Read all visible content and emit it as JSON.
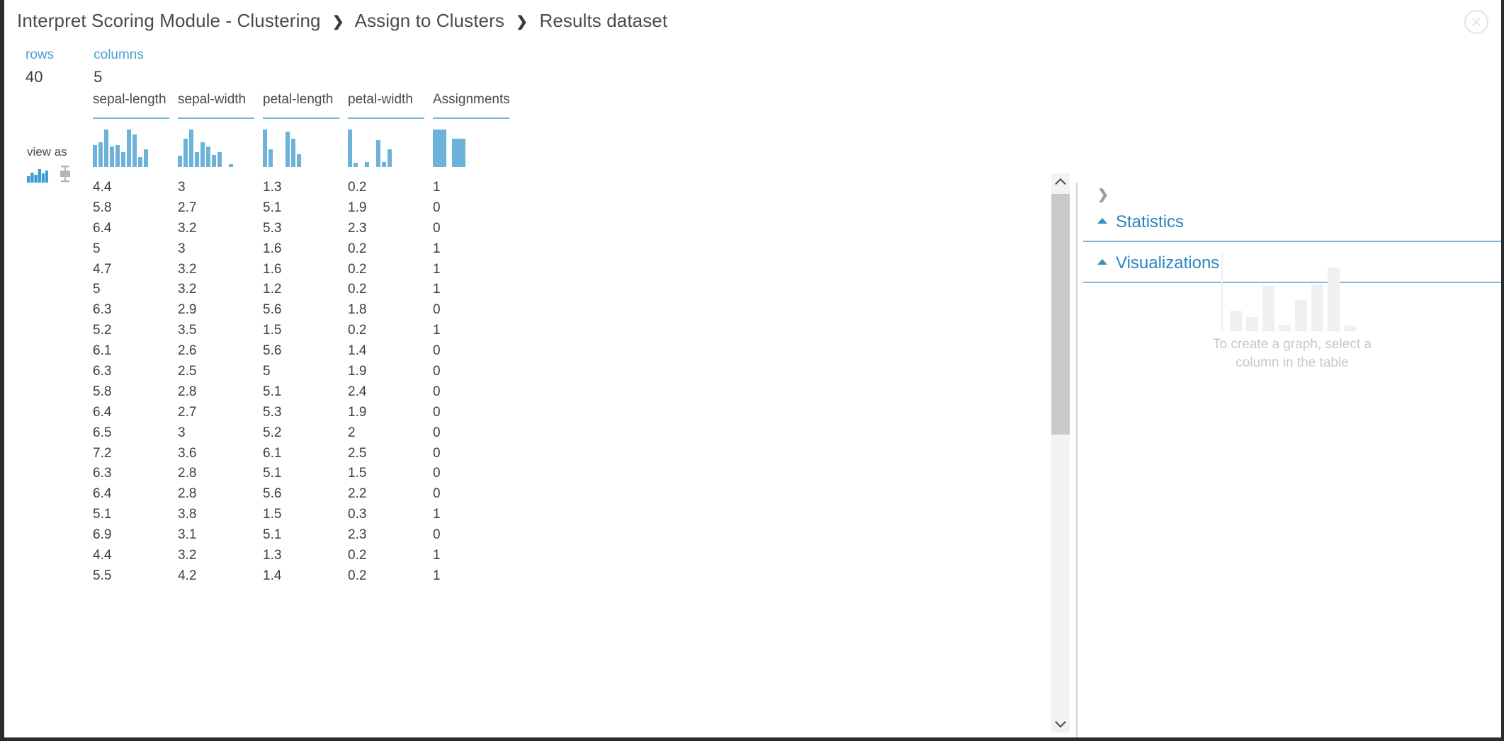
{
  "window": {
    "close_icon": "close-circle-icon"
  },
  "breadcrumb": {
    "separator": "❯",
    "items": [
      "Interpret Scoring Module - Clustering",
      "Assign to Clusters",
      "Results dataset"
    ]
  },
  "counters": [
    {
      "label": "rows",
      "value": "40"
    },
    {
      "label": "columns",
      "value": "5"
    }
  ],
  "view_as": {
    "label": "view as",
    "options": [
      {
        "name": "histogram-icon",
        "selected": true
      },
      {
        "name": "boxplot-icon",
        "selected": false
      }
    ]
  },
  "table": {
    "columns": [
      "sepal-length",
      "sepal-width",
      "petal-length",
      "petal-width",
      "Assignments"
    ],
    "rows": [
      [
        "4.4",
        "3",
        "1.3",
        "0.2",
        "1"
      ],
      [
        "5.8",
        "2.7",
        "5.1",
        "1.9",
        "0"
      ],
      [
        "6.4",
        "3.2",
        "5.3",
        "2.3",
        "0"
      ],
      [
        "5",
        "3",
        "1.6",
        "0.2",
        "1"
      ],
      [
        "4.7",
        "3.2",
        "1.6",
        "0.2",
        "1"
      ],
      [
        "5",
        "3.2",
        "1.2",
        "0.2",
        "1"
      ],
      [
        "6.3",
        "2.9",
        "5.6",
        "1.8",
        "0"
      ],
      [
        "5.2",
        "3.5",
        "1.5",
        "0.2",
        "1"
      ],
      [
        "6.1",
        "2.6",
        "5.6",
        "1.4",
        "0"
      ],
      [
        "6.3",
        "2.5",
        "5",
        "1.9",
        "0"
      ],
      [
        "5.8",
        "2.8",
        "5.1",
        "2.4",
        "0"
      ],
      [
        "6.4",
        "2.7",
        "5.3",
        "1.9",
        "0"
      ],
      [
        "6.5",
        "3",
        "5.2",
        "2",
        "0"
      ],
      [
        "7.2",
        "3.6",
        "6.1",
        "2.5",
        "0"
      ],
      [
        "6.3",
        "2.8",
        "5.1",
        "1.5",
        "0"
      ],
      [
        "6.4",
        "2.8",
        "5.6",
        "2.2",
        "0"
      ],
      [
        "5.1",
        "3.8",
        "1.5",
        "0.3",
        "1"
      ],
      [
        "6.9",
        "3.1",
        "5.1",
        "2.3",
        "0"
      ],
      [
        "4.4",
        "3.2",
        "1.3",
        "0.2",
        "1"
      ],
      [
        "5.5",
        "4.2",
        "1.4",
        "0.2",
        "1"
      ]
    ]
  },
  "chart_data": [
    {
      "type": "bar",
      "title": "sepal-length",
      "categories": [
        "1",
        "2",
        "3",
        "4",
        "5",
        "6",
        "7",
        "8",
        "9",
        "10"
      ],
      "values": [
        0.55,
        0.62,
        0.95,
        0.52,
        0.55,
        0.38,
        0.95,
        0.82,
        0.25,
        0.45
      ],
      "ylim": [
        0,
        1
      ],
      "xlabel": "",
      "ylabel": ""
    },
    {
      "type": "bar",
      "title": "sepal-width",
      "categories": [
        "1",
        "2",
        "3",
        "4",
        "5",
        "6",
        "7",
        "8",
        "9",
        "10"
      ],
      "values": [
        0.28,
        0.72,
        0.95,
        0.38,
        0.62,
        0.52,
        0.3,
        0.38,
        0.0,
        0.08
      ],
      "ylim": [
        0,
        1
      ],
      "xlabel": "",
      "ylabel": ""
    },
    {
      "type": "bar",
      "title": "petal-length",
      "categories": [
        "1",
        "2",
        "3",
        "4",
        "5",
        "6",
        "7",
        "8",
        "9",
        "10"
      ],
      "values": [
        0.95,
        0.45,
        0.0,
        0.0,
        0.9,
        0.72,
        0.32,
        0.0,
        0.0,
        0.0
      ],
      "ylim": [
        0,
        1
      ],
      "xlabel": "",
      "ylabel": ""
    },
    {
      "type": "bar",
      "title": "petal-width",
      "categories": [
        "1",
        "2",
        "3",
        "4",
        "5",
        "6",
        "7",
        "8",
        "9",
        "10"
      ],
      "values": [
        0.95,
        0.1,
        0.0,
        0.12,
        0.0,
        0.68,
        0.13,
        0.45,
        0.0,
        0.0
      ],
      "ylim": [
        0,
        1
      ],
      "xlabel": "",
      "ylabel": ""
    },
    {
      "type": "bar",
      "title": "Assignments",
      "categories": [
        "0",
        "1"
      ],
      "values": [
        0.95,
        0.72
      ],
      "ylim": [
        0,
        1
      ],
      "xlabel": "",
      "ylabel": ""
    },
    {
      "type": "bar",
      "title": "visualizations-placeholder",
      "categories": [
        "1",
        "2",
        "3",
        "4",
        "5",
        "6",
        "7",
        "8"
      ],
      "values": [
        0.26,
        0.18,
        0.58,
        0.08,
        0.4,
        0.6,
        0.82,
        0.07
      ],
      "ylim": [
        0,
        1
      ],
      "xlabel": "",
      "ylabel": ""
    }
  ],
  "right_panel": {
    "expander_icon": "chevron-right-icon",
    "sections": [
      {
        "title": "Statistics"
      },
      {
        "title": "Visualizations"
      }
    ],
    "placeholder_text_line1": "To create a graph, select a",
    "placeholder_text_line2": "column in the table"
  },
  "scrollbar": {
    "up_icon": "chevron-up-icon",
    "down_icon": "chevron-down-icon"
  },
  "colors": {
    "accent": "#2b85bf",
    "bar": "#6cb2d9",
    "rule": "#76b5da",
    "text": "#3d3d3d"
  }
}
